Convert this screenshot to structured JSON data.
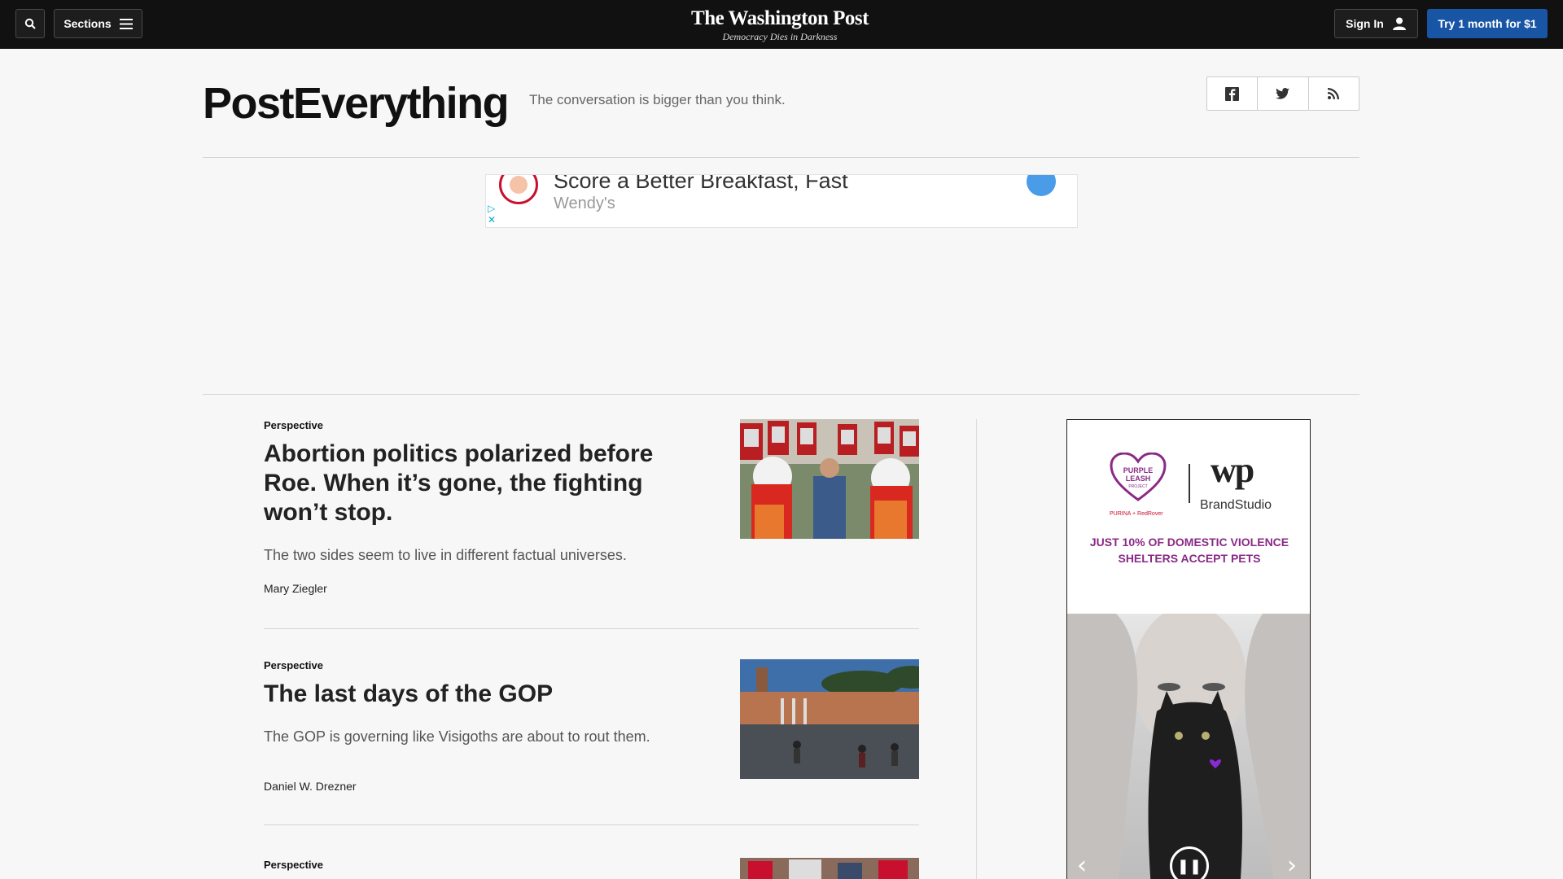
{
  "nav": {
    "sections_label": "Sections",
    "masthead": "The Washington Post",
    "tagline": "Democracy Dies in Darkness",
    "signin_label": "Sign In",
    "trial_label": "Try 1 month for $1",
    "trial_color": "#1955a5"
  },
  "header": {
    "title": "PostEverything",
    "tagline": "The conversation is bigger than you think.",
    "share_icons": [
      "facebook-icon",
      "twitter-icon",
      "rss-icon"
    ]
  },
  "top_ad": {
    "headline": "Score a Better Breakfast, Fast",
    "brand": "Wendy's"
  },
  "articles": [
    {
      "kicker": "Perspective",
      "headline": "Abortion politics polarized before Roe. When it’s gone, the fighting won’t stop.",
      "blurb": "The two sides seem to live in different factual universes.",
      "byline": "Mary Ziegler"
    },
    {
      "kicker": "Perspective",
      "headline": "The last days of the GOP",
      "blurb": "The GOP is governing like Visigoths are about to rout them.",
      "byline": "Daniel W. Drezner"
    },
    {
      "kicker": "Perspective"
    }
  ],
  "side_ad": {
    "brand_left": "PURPLE LEASH PROJECT",
    "brand_right": "wp",
    "brand_studio": "BrandStudio",
    "partners": "PURINA + RedRover",
    "message": "JUST 10% OF DOMESTIC VIOLENCE SHELTERS ACCEPT PETS"
  }
}
